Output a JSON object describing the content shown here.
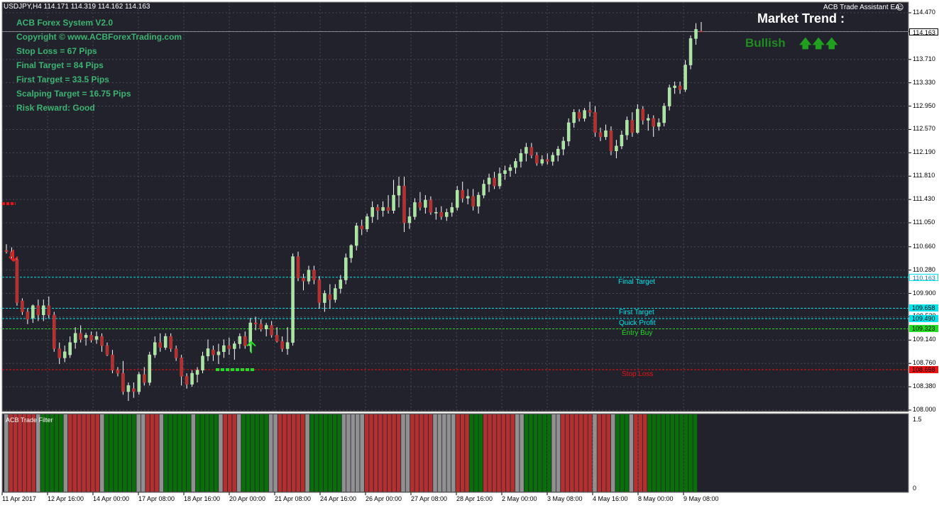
{
  "window": {
    "symbol_header": "USDJPY,H4  114.171 114.319 114.162 114.163",
    "ea_label": "ACB Trade Assistant EA",
    "ea_smile": "☺"
  },
  "info_panel": [
    "ACB Forex System V2.0",
    "Copyright ©  www.ACBForexTrading.com",
    "Stop Loss = 67 Pips",
    "Final Target = 84 Pips",
    "First Target = 33.5 Pips",
    "Scalping Target = 16.75 Pips",
    "Risk Reward: Good"
  ],
  "market_trend": {
    "title": "Market Trend :",
    "value": "Bullish",
    "arrows": "🡅🡅🡅"
  },
  "levels": {
    "final_target": {
      "label": "Final Target",
      "price": "110.163",
      "value": 110.163,
      "color": "#00e5ee"
    },
    "first_target": {
      "label": "First Target",
      "price": "109.658",
      "value": 109.658,
      "color": "#00e5ee"
    },
    "quick_profit": {
      "label": "Quick Profit",
      "price": "109.490",
      "value": 109.49,
      "color": "#00e5ee"
    },
    "entry_buy": {
      "label": "Entry Buy",
      "price": "109.323",
      "value": 109.323,
      "color": "#22dd22"
    },
    "stop_loss": {
      "label": "Stop Loss",
      "price": "108.658",
      "value": 108.658,
      "color": "#ee1111"
    }
  },
  "current_price": "114.163",
  "price_axis": [
    "114.470",
    "114.163",
    "113.710",
    "113.330",
    "112.950",
    "112.570",
    "112.190",
    "111.810",
    "111.430",
    "111.050",
    "110.660",
    "110.280",
    "109.900",
    "109.520",
    "109.140",
    "108.760",
    "108.380",
    "108.000"
  ],
  "time_axis": [
    "11 Apr 2017",
    "12 Apr 16:00",
    "14 Apr 00:00",
    "17 Apr 08:00",
    "18 Apr 16:00",
    "20 Apr 00:00",
    "21 Apr 08:00",
    "24 Apr 16:00",
    "26 Apr 00:00",
    "27 Apr 08:00",
    "28 Apr 16:00",
    "2 May 00:00",
    "3 May 08:00",
    "4 May 16:00",
    "8 May 00:00",
    "9 May 08:00"
  ],
  "indicator": {
    "title": "ACB Trade Filter",
    "axis_max": "1.5",
    "axis_min": "0",
    "colors": {
      "up": "#0a6e0a",
      "down": "#b23030",
      "neutral": "#909090"
    }
  },
  "colors": {
    "background": "#22222c",
    "grid": "#4a4a56",
    "bull_candle": "#a8e6a0",
    "bear_candle": "#b23030",
    "wick": "#ffffff"
  },
  "chart_data": {
    "type": "candlestick",
    "symbol": "USDJPY",
    "timeframe": "H4",
    "ylim": [
      108.0,
      114.47
    ],
    "candles": [
      {
        "o": 110.6,
        "h": 110.7,
        "l": 110.55,
        "c": 110.58
      },
      {
        "o": 110.58,
        "h": 110.65,
        "l": 110.45,
        "c": 110.5
      },
      {
        "o": 110.45,
        "h": 110.5,
        "l": 109.7,
        "c": 109.75
      },
      {
        "o": 109.78,
        "h": 109.82,
        "l": 109.55,
        "c": 109.6
      },
      {
        "o": 109.6,
        "h": 109.65,
        "l": 109.4,
        "c": 109.48
      },
      {
        "o": 109.5,
        "h": 109.72,
        "l": 109.42,
        "c": 109.7
      },
      {
        "o": 109.7,
        "h": 109.8,
        "l": 109.45,
        "c": 109.55
      },
      {
        "o": 109.55,
        "h": 109.8,
        "l": 109.45,
        "c": 109.7
      },
      {
        "o": 109.7,
        "h": 109.85,
        "l": 109.5,
        "c": 109.55
      },
      {
        "o": 109.55,
        "h": 109.6,
        "l": 108.95,
        "c": 109.0
      },
      {
        "o": 109.0,
        "h": 109.1,
        "l": 108.75,
        "c": 108.85
      },
      {
        "o": 108.85,
        "h": 109.05,
        "l": 108.78,
        "c": 108.95
      },
      {
        "o": 108.9,
        "h": 109.2,
        "l": 108.85,
        "c": 109.1
      },
      {
        "o": 109.1,
        "h": 109.35,
        "l": 109.0,
        "c": 109.25
      },
      {
        "o": 109.25,
        "h": 109.38,
        "l": 109.1,
        "c": 109.15
      },
      {
        "o": 109.18,
        "h": 109.26,
        "l": 109.05,
        "c": 109.22
      },
      {
        "o": 109.22,
        "h": 109.28,
        "l": 109.1,
        "c": 109.14
      },
      {
        "o": 109.15,
        "h": 109.28,
        "l": 109.08,
        "c": 109.2
      },
      {
        "o": 109.2,
        "h": 109.25,
        "l": 108.95,
        "c": 109.05
      },
      {
        "o": 109.05,
        "h": 109.1,
        "l": 108.88,
        "c": 108.9
      },
      {
        "o": 108.9,
        "h": 108.98,
        "l": 108.6,
        "c": 108.65
      },
      {
        "o": 108.65,
        "h": 108.7,
        "l": 108.55,
        "c": 108.6
      },
      {
        "o": 108.6,
        "h": 108.8,
        "l": 108.25,
        "c": 108.3
      },
      {
        "o": 108.3,
        "h": 108.45,
        "l": 108.15,
        "c": 108.4
      },
      {
        "o": 108.35,
        "h": 108.45,
        "l": 108.2,
        "c": 108.3
      },
      {
        "o": 108.3,
        "h": 108.62,
        "l": 108.25,
        "c": 108.58
      },
      {
        "o": 108.58,
        "h": 108.7,
        "l": 108.4,
        "c": 108.45
      },
      {
        "o": 108.45,
        "h": 108.95,
        "l": 108.4,
        "c": 108.9
      },
      {
        "o": 108.9,
        "h": 109.2,
        "l": 108.85,
        "c": 109.1
      },
      {
        "o": 109.1,
        "h": 109.25,
        "l": 108.95,
        "c": 109.02
      },
      {
        "o": 109.02,
        "h": 109.25,
        "l": 108.98,
        "c": 109.2
      },
      {
        "o": 109.2,
        "h": 109.25,
        "l": 108.95,
        "c": 109.0
      },
      {
        "o": 109.0,
        "h": 109.05,
        "l": 108.8,
        "c": 108.85
      },
      {
        "o": 108.85,
        "h": 108.9,
        "l": 108.4,
        "c": 108.55
      },
      {
        "o": 108.55,
        "h": 108.6,
        "l": 108.35,
        "c": 108.42
      },
      {
        "o": 108.42,
        "h": 108.65,
        "l": 108.38,
        "c": 108.6
      },
      {
        "o": 108.58,
        "h": 108.7,
        "l": 108.45,
        "c": 108.65
      },
      {
        "o": 108.65,
        "h": 108.95,
        "l": 108.6,
        "c": 108.88
      },
      {
        "o": 108.88,
        "h": 109.15,
        "l": 108.8,
        "c": 109.0
      },
      {
        "o": 108.98,
        "h": 109.05,
        "l": 108.8,
        "c": 108.9
      },
      {
        "o": 108.9,
        "h": 109.08,
        "l": 108.75,
        "c": 108.95
      },
      {
        "o": 108.95,
        "h": 109.15,
        "l": 108.85,
        "c": 109.05
      },
      {
        "o": 109.05,
        "h": 109.18,
        "l": 108.9,
        "c": 109.0
      },
      {
        "o": 109.0,
        "h": 109.12,
        "l": 108.82,
        "c": 109.08
      },
      {
        "o": 109.08,
        "h": 109.25,
        "l": 109.0,
        "c": 109.2
      },
      {
        "o": 109.2,
        "h": 109.28,
        "l": 109.0,
        "c": 109.05
      },
      {
        "o": 109.05,
        "h": 109.5,
        "l": 108.95,
        "c": 109.42
      },
      {
        "o": 109.42,
        "h": 109.52,
        "l": 109.3,
        "c": 109.4
      },
      {
        "o": 109.4,
        "h": 109.48,
        "l": 109.28,
        "c": 109.32
      },
      {
        "o": 109.32,
        "h": 109.42,
        "l": 109.2,
        "c": 109.38
      },
      {
        "o": 109.38,
        "h": 109.45,
        "l": 109.18,
        "c": 109.22
      },
      {
        "o": 109.22,
        "h": 109.35,
        "l": 109.1,
        "c": 109.12
      },
      {
        "o": 109.12,
        "h": 109.2,
        "l": 108.95,
        "c": 109.0
      },
      {
        "o": 109.0,
        "h": 109.35,
        "l": 108.9,
        "c": 109.1
      },
      {
        "o": 109.1,
        "h": 110.55,
        "l": 109.05,
        "c": 110.5
      },
      {
        "o": 110.5,
        "h": 110.58,
        "l": 110.1,
        "c": 110.15
      },
      {
        "o": 110.15,
        "h": 110.22,
        "l": 109.95,
        "c": 110.1
      },
      {
        "o": 110.1,
        "h": 110.35,
        "l": 110.05,
        "c": 110.28
      },
      {
        "o": 110.28,
        "h": 110.35,
        "l": 110.05,
        "c": 110.12
      },
      {
        "o": 110.12,
        "h": 110.18,
        "l": 109.65,
        "c": 109.75
      },
      {
        "o": 109.75,
        "h": 109.95,
        "l": 109.6,
        "c": 109.9
      },
      {
        "o": 109.88,
        "h": 110.05,
        "l": 109.65,
        "c": 109.8
      },
      {
        "o": 109.8,
        "h": 110.05,
        "l": 109.75,
        "c": 109.98
      },
      {
        "o": 109.98,
        "h": 110.2,
        "l": 109.9,
        "c": 110.12
      },
      {
        "o": 110.12,
        "h": 110.55,
        "l": 110.05,
        "c": 110.48
      },
      {
        "o": 110.48,
        "h": 110.7,
        "l": 110.4,
        "c": 110.68
      },
      {
        "o": 110.68,
        "h": 111.05,
        "l": 110.6,
        "c": 111.0
      },
      {
        "o": 111.0,
        "h": 111.1,
        "l": 110.85,
        "c": 110.95
      },
      {
        "o": 110.95,
        "h": 111.2,
        "l": 110.9,
        "c": 111.15
      },
      {
        "o": 111.15,
        "h": 111.4,
        "l": 111.05,
        "c": 111.3
      },
      {
        "o": 111.3,
        "h": 111.35,
        "l": 111.1,
        "c": 111.25
      },
      {
        "o": 111.25,
        "h": 111.4,
        "l": 111.15,
        "c": 111.3
      },
      {
        "o": 111.3,
        "h": 111.5,
        "l": 111.2,
        "c": 111.25
      },
      {
        "o": 111.25,
        "h": 111.75,
        "l": 111.2,
        "c": 111.5
      },
      {
        "o": 111.5,
        "h": 111.8,
        "l": 111.3,
        "c": 111.65
      },
      {
        "o": 111.65,
        "h": 111.8,
        "l": 110.9,
        "c": 111.05
      },
      {
        "o": 111.05,
        "h": 111.3,
        "l": 110.95,
        "c": 111.15
      },
      {
        "o": 111.15,
        "h": 111.45,
        "l": 111.1,
        "c": 111.38
      },
      {
        "o": 111.38,
        "h": 111.55,
        "l": 111.25,
        "c": 111.3
      },
      {
        "o": 111.3,
        "h": 111.5,
        "l": 111.2,
        "c": 111.42
      },
      {
        "o": 111.42,
        "h": 111.48,
        "l": 111.18,
        "c": 111.22
      },
      {
        "o": 111.22,
        "h": 111.3,
        "l": 111.1,
        "c": 111.22
      },
      {
        "o": 111.22,
        "h": 111.32,
        "l": 111.1,
        "c": 111.15
      },
      {
        "o": 111.15,
        "h": 111.28,
        "l": 111.08,
        "c": 111.22
      },
      {
        "o": 111.22,
        "h": 111.38,
        "l": 111.15,
        "c": 111.3
      },
      {
        "o": 111.3,
        "h": 111.65,
        "l": 111.25,
        "c": 111.58
      },
      {
        "o": 111.58,
        "h": 111.72,
        "l": 111.38,
        "c": 111.45
      },
      {
        "o": 111.45,
        "h": 111.6,
        "l": 111.35,
        "c": 111.48
      },
      {
        "o": 111.48,
        "h": 111.6,
        "l": 111.25,
        "c": 111.32
      },
      {
        "o": 111.32,
        "h": 111.55,
        "l": 111.2,
        "c": 111.5
      },
      {
        "o": 111.5,
        "h": 111.75,
        "l": 111.45,
        "c": 111.68
      },
      {
        "o": 111.68,
        "h": 111.85,
        "l": 111.55,
        "c": 111.78
      },
      {
        "o": 111.78,
        "h": 111.88,
        "l": 111.6,
        "c": 111.65
      },
      {
        "o": 111.65,
        "h": 111.95,
        "l": 111.6,
        "c": 111.85
      },
      {
        "o": 111.85,
        "h": 111.98,
        "l": 111.75,
        "c": 111.9
      },
      {
        "o": 111.9,
        "h": 112.0,
        "l": 111.8,
        "c": 111.95
      },
      {
        "o": 111.95,
        "h": 112.1,
        "l": 111.85,
        "c": 112.05
      },
      {
        "o": 112.05,
        "h": 112.25,
        "l": 111.95,
        "c": 112.18
      },
      {
        "o": 112.18,
        "h": 112.35,
        "l": 112.05,
        "c": 112.28
      },
      {
        "o": 112.28,
        "h": 112.35,
        "l": 112.1,
        "c": 112.15
      },
      {
        "o": 112.15,
        "h": 112.2,
        "l": 111.98,
        "c": 112.02
      },
      {
        "o": 112.02,
        "h": 112.15,
        "l": 111.98,
        "c": 112.08
      },
      {
        "o": 112.08,
        "h": 112.18,
        "l": 112.0,
        "c": 112.05
      },
      {
        "o": 112.05,
        "h": 112.2,
        "l": 111.98,
        "c": 112.15
      },
      {
        "o": 112.15,
        "h": 112.3,
        "l": 112.05,
        "c": 112.25
      },
      {
        "o": 112.25,
        "h": 112.45,
        "l": 112.15,
        "c": 112.38
      },
      {
        "o": 112.38,
        "h": 112.75,
        "l": 112.3,
        "c": 112.68
      },
      {
        "o": 112.68,
        "h": 112.9,
        "l": 112.6,
        "c": 112.85
      },
      {
        "o": 112.85,
        "h": 112.9,
        "l": 112.7,
        "c": 112.75
      },
      {
        "o": 112.75,
        "h": 112.92,
        "l": 112.7,
        "c": 112.88
      },
      {
        "o": 112.88,
        "h": 113.02,
        "l": 112.78,
        "c": 112.85
      },
      {
        "o": 112.85,
        "h": 112.95,
        "l": 112.45,
        "c": 112.52
      },
      {
        "o": 112.52,
        "h": 112.6,
        "l": 112.38,
        "c": 112.45
      },
      {
        "o": 112.45,
        "h": 112.65,
        "l": 112.4,
        "c": 112.55
      },
      {
        "o": 112.55,
        "h": 112.62,
        "l": 112.15,
        "c": 112.22
      },
      {
        "o": 112.22,
        "h": 112.4,
        "l": 112.1,
        "c": 112.3
      },
      {
        "o": 112.3,
        "h": 112.55,
        "l": 112.25,
        "c": 112.48
      },
      {
        "o": 112.48,
        "h": 112.78,
        "l": 112.4,
        "c": 112.72
      },
      {
        "o": 112.72,
        "h": 112.85,
        "l": 112.45,
        "c": 112.52
      },
      {
        "o": 112.52,
        "h": 112.98,
        "l": 112.5,
        "c": 112.9
      },
      {
        "o": 112.9,
        "h": 112.95,
        "l": 112.65,
        "c": 112.72
      },
      {
        "o": 112.72,
        "h": 112.82,
        "l": 112.55,
        "c": 112.75
      },
      {
        "o": 112.75,
        "h": 112.8,
        "l": 112.45,
        "c": 112.62
      },
      {
        "o": 112.62,
        "h": 112.75,
        "l": 112.55,
        "c": 112.68
      },
      {
        "o": 112.68,
        "h": 113.0,
        "l": 112.62,
        "c": 112.95
      },
      {
        "o": 112.95,
        "h": 113.3,
        "l": 112.88,
        "c": 113.25
      },
      {
        "o": 113.25,
        "h": 113.35,
        "l": 113.15,
        "c": 113.28
      },
      {
        "o": 113.28,
        "h": 113.35,
        "l": 113.15,
        "c": 113.22
      },
      {
        "o": 113.22,
        "h": 113.7,
        "l": 113.18,
        "c": 113.62
      },
      {
        "o": 113.62,
        "h": 114.1,
        "l": 113.55,
        "c": 114.05
      },
      {
        "o": 114.05,
        "h": 114.3,
        "l": 113.95,
        "c": 114.2
      },
      {
        "o": 114.17,
        "h": 114.32,
        "l": 114.16,
        "c": 114.16
      }
    ],
    "filter_bars": "NDDDDDDNUUUUUNDDDDDDDNUUUUUUUNNDDDNUUUUUUNUUUUUNDDDNUUUUUUNNDDDDDDNUUUUUUUNNNNNDDDDDDDDNNDDDDDNNNNNDDDUUUDDDDDDDNNUUUUUUNNDDDDDDDNDDDNUUUNDDDUUUUUUUUUUU"
  }
}
